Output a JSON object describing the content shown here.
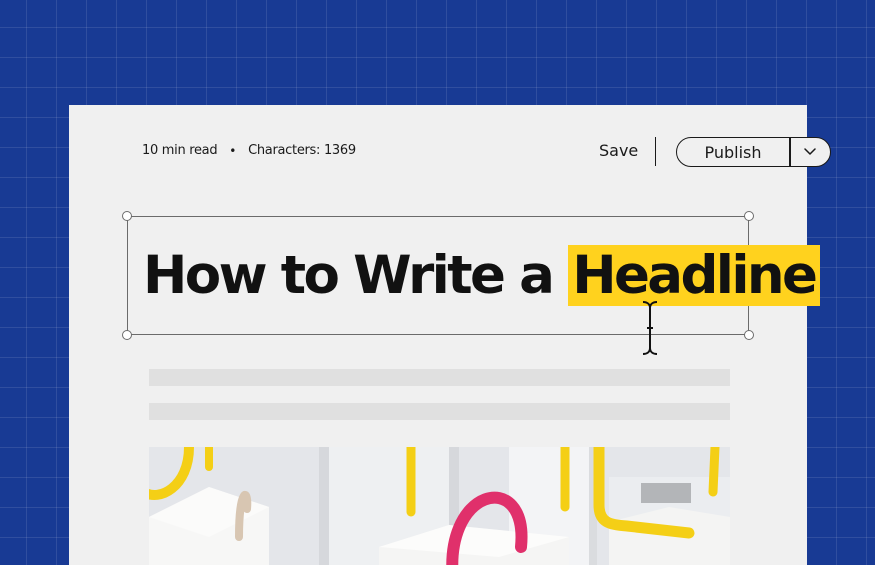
{
  "meta": {
    "read_time": "10 min read",
    "separator": "•",
    "characters": "Characters: 1369"
  },
  "toolbar": {
    "save_label": "Save",
    "publish_label": "Publish"
  },
  "headline": {
    "prefix": "How to Write a",
    "highlighted": "Headline"
  },
  "colors": {
    "background": "#183a94",
    "page": "#f0f0f0",
    "highlight": "#ffd21e",
    "placeholder_bar": "#e0e0e0"
  },
  "icons": {
    "publish_dropdown": "chevron-down-icon",
    "text_cursor": "text-cursor-icon"
  }
}
